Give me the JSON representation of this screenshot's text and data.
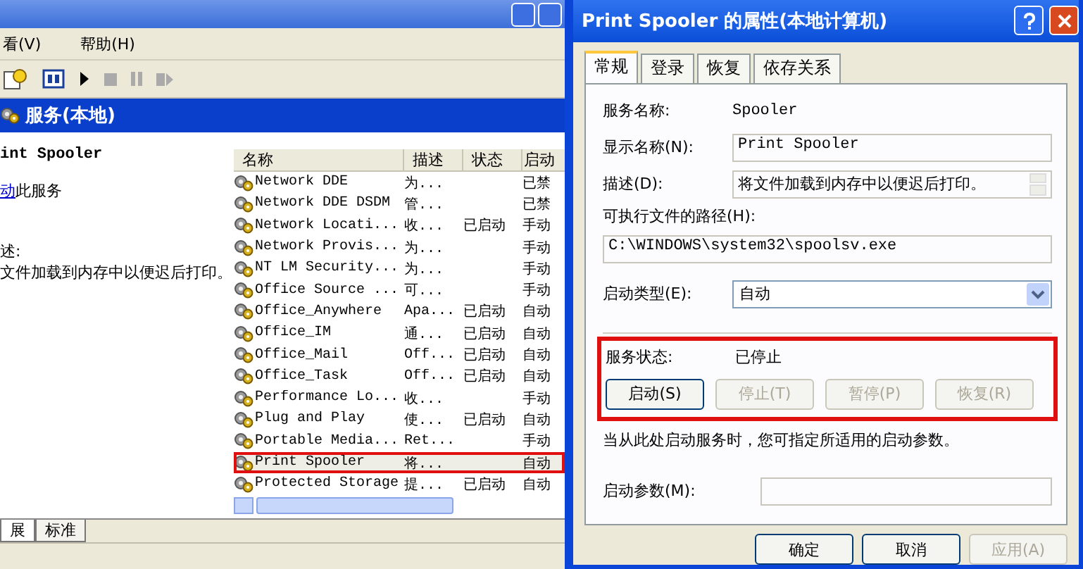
{
  "services_window": {
    "menu": [
      "看(V)",
      "帮助(H)"
    ],
    "header": "服务(本地)",
    "detail": {
      "title": "int Spooler",
      "action_link": "动",
      "action_text": "此服务",
      "description_label": "述:",
      "description": "文件加载到内存中以便迟后打印。"
    },
    "columns": [
      "名称",
      "描述",
      "状态",
      "启动"
    ],
    "rows": [
      {
        "name": "Network DDE",
        "description": "为...",
        "status": "",
        "startup": "已禁",
        "highlighted": false
      },
      {
        "name": "Network DDE DSDM",
        "description": "管...",
        "status": "",
        "startup": "已禁",
        "highlighted": false
      },
      {
        "name": "Network Locati...",
        "description": "收...",
        "status": "已启动",
        "startup": "手动",
        "highlighted": false
      },
      {
        "name": "Network Provis...",
        "description": "为...",
        "status": "",
        "startup": "手动",
        "highlighted": false
      },
      {
        "name": "NT LM Security...",
        "description": "为...",
        "status": "",
        "startup": "手动",
        "highlighted": false
      },
      {
        "name": "Office Source ...",
        "description": "可...",
        "status": "",
        "startup": "手动",
        "highlighted": false
      },
      {
        "name": "Office_Anywhere",
        "description": "Apa...",
        "status": "已启动",
        "startup": "自动",
        "highlighted": false
      },
      {
        "name": "Office_IM",
        "description": "通...",
        "status": "已启动",
        "startup": "自动",
        "highlighted": false
      },
      {
        "name": "Office_Mail",
        "description": "Off...",
        "status": "已启动",
        "startup": "自动",
        "highlighted": false
      },
      {
        "name": "Office_Task",
        "description": "Off...",
        "status": "已启动",
        "startup": "自动",
        "highlighted": false
      },
      {
        "name": "Performance Lo...",
        "description": "收...",
        "status": "",
        "startup": "手动",
        "highlighted": false
      },
      {
        "name": "Plug and Play",
        "description": "使...",
        "status": "已启动",
        "startup": "自动",
        "highlighted": false
      },
      {
        "name": "Portable Media...",
        "description": "Ret...",
        "status": "",
        "startup": "手动",
        "highlighted": false
      },
      {
        "name": "Print Spooler",
        "description": "将...",
        "status": "",
        "startup": "自动",
        "highlighted": true
      },
      {
        "name": "Protected Storage",
        "description": "提...",
        "status": "已启动",
        "startup": "自动",
        "highlighted": false
      }
    ],
    "view_tabs": [
      {
        "label": "展",
        "selected": true
      },
      {
        "label": "标准",
        "selected": false
      }
    ]
  },
  "dialog": {
    "title": "Print Spooler 的属性(本地计算机)",
    "tabs": [
      {
        "label": "常规",
        "selected": true
      },
      {
        "label": "登录",
        "selected": false
      },
      {
        "label": "恢复",
        "selected": false
      },
      {
        "label": "依存关系",
        "selected": false
      }
    ],
    "service_name_label": "服务名称:",
    "service_name": "Spooler",
    "display_name_label": "显示名称(N):",
    "display_name": "Print Spooler",
    "description_label": "描述(D):",
    "description": "将文件加载到内存中以便迟后打印。",
    "path_label": "可执行文件的路径(H):",
    "path": "C:\\WINDOWS\\system32\\spoolsv.exe",
    "startup_type_label": "启动类型(E):",
    "startup_type": "自动",
    "status_label": "服务状态:",
    "status": "已停止",
    "status_highlighted": true,
    "control_buttons": [
      {
        "label": "启动(S)",
        "disabled": false
      },
      {
        "label": "停止(T)",
        "disabled": true
      },
      {
        "label": "暂停(P)",
        "disabled": true
      },
      {
        "label": "恢复(R)",
        "disabled": true
      }
    ],
    "hint": "当从此处启动服务时，您可指定所适用的启动参数。",
    "params_label": "启动参数(M):",
    "buttons": [
      {
        "label": "确定",
        "disabled": false
      },
      {
        "label": "取消",
        "disabled": false
      },
      {
        "label": "应用(A)",
        "disabled": true
      }
    ]
  }
}
